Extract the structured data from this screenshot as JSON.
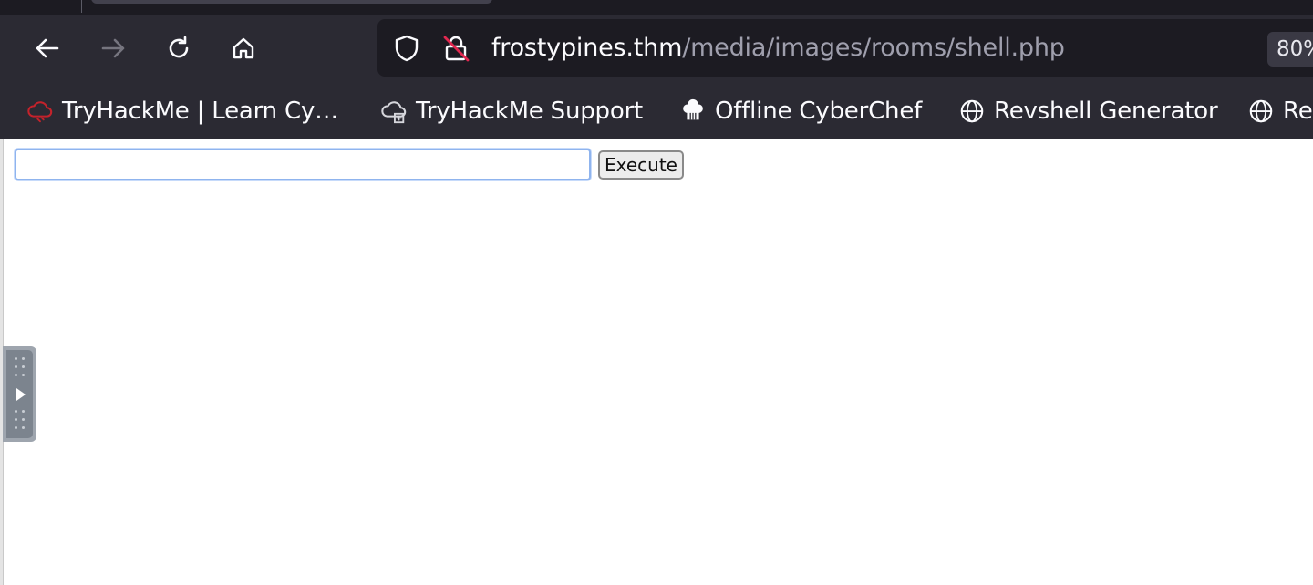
{
  "browser": {
    "url_host": "frostypines.thm",
    "url_path": "/media/images/rooms/shell.php",
    "zoom": "80%",
    "nav_icons": [
      "back-icon",
      "forward-icon",
      "reload-icon",
      "home-icon"
    ],
    "url_icons": [
      "shield-icon",
      "insecure-lock-icon"
    ]
  },
  "bookmarks": [
    {
      "label": "TryHackMe | Learn Cy…",
      "icon": "tryhackme-cloud-icon"
    },
    {
      "label": "TryHackMe Support",
      "icon": "support-cloud-icon"
    },
    {
      "label": "Offline CyberChef",
      "icon": "chef-hat-icon"
    },
    {
      "label": "Revshell Generator",
      "icon": "globe-icon"
    },
    {
      "label": "Re",
      "icon": "globe-icon"
    }
  ],
  "page": {
    "command_input_value": "",
    "execute_label": "Execute"
  },
  "colors": {
    "chrome_bg": "#2b2a33",
    "urlbar_bg": "#1c1b22",
    "tryhackme_red": "#c4222b",
    "input_focus": "#8fb4ee"
  }
}
